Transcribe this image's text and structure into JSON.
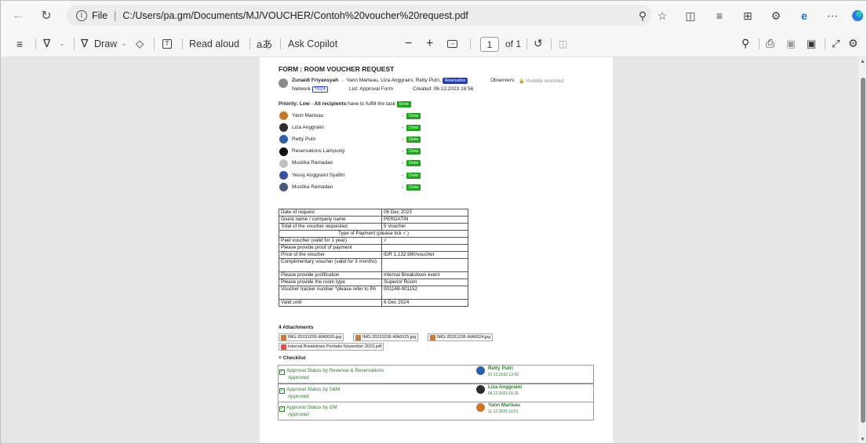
{
  "browser": {
    "file_label": "File",
    "url": "C:/Users/pa.gm/Documents/MJ/VOUCHER/Contoh%20voucher%20request.pdf"
  },
  "pdf_toolbar": {
    "draw_label": "Draw",
    "read_aloud_label": "Read aloud",
    "ask_copilot_label": "Ask Copilot",
    "page_number": "1",
    "page_total": "of 1"
  },
  "form": {
    "title": "FORM : ROOM VOUCHER REQUEST",
    "author": "Zunaidi Friyansyah",
    "arrow": "→",
    "recipients": "Yann Marteau, Liza Anggraini, Retty Putri,",
    "recipients_tag": "Reservation",
    "observers_label": "Observers:",
    "visibility": "Visibility restricted",
    "network_label": "Network",
    "network_tag": "TRIZA",
    "list_label": "List: Approval Form",
    "created": "Created: 06.12.2023 16:56",
    "priority_label": "Priority: Low",
    "priority_sep": " - ",
    "priority_text_bold": "All recipients",
    "priority_text": " have to fulfill the task",
    "done_label": "Done",
    "task_dash": "-",
    "tasks": [
      {
        "name": "Yann Marteau",
        "color": "#c9772f"
      },
      {
        "name": "Liza Anggraini",
        "color": "#2c2c2c"
      },
      {
        "name": "Retty Putri",
        "color": "#2f5fa8"
      },
      {
        "name": "Reservations Lampung",
        "color": "#111111"
      },
      {
        "name": "Mustika Ramadan",
        "color": "#bfbfbf"
      },
      {
        "name": "Yessy Anggraini Syafitri",
        "color": "#3a4fa0"
      },
      {
        "name": "Mustika Ramadan",
        "color": "#4a5a7a"
      }
    ]
  },
  "voucher_table": {
    "rows": [
      {
        "label": "Date of request",
        "value": "06 Dec 2023"
      },
      {
        "label": "Guest name / company name",
        "value": "PERDATIN"
      },
      {
        "label": "Total of the voucher requested",
        "value": "5 Voucher"
      },
      {
        "label": "Type of Payment (please tick √ )",
        "value": "",
        "span": true
      },
      {
        "label": "Paid voucher (valid for 1 year)",
        "value": "√"
      },
      {
        "label": "Please provide proof of payment",
        "value": ""
      },
      {
        "label": "Price of the voucher",
        "value": "IDR 1.132.980/voucher"
      },
      {
        "label": "Complimentary voucher (valid for 3 months)",
        "value": "",
        "tall": true
      },
      {
        "label": "Please provide justification",
        "value": "Internal Breakdown event"
      },
      {
        "label": "Please provide the room type",
        "value": "Superior Room"
      },
      {
        "label": "Voucher tracker number *please refer to PA",
        "value": "001148-001152",
        "tall": true
      },
      {
        "label": "Valid until",
        "value": "6 Dec 2024"
      }
    ]
  },
  "attachments": {
    "title": "4 Attachments",
    "files": [
      {
        "name": "IMG-20231206-WA0026.jpg",
        "type": "img"
      },
      {
        "name": "IMG-20231206-WA0025.jpg",
        "type": "img"
      },
      {
        "name": "IMG-20231206-WA0024.jpg",
        "type": "img"
      },
      {
        "name": "Internal Breakdown Perdatin November 2023.pdf",
        "type": "pdf"
      }
    ]
  },
  "checklist": {
    "title": "Checklist",
    "items": [
      {
        "label": "Approval Status by Revenue & Reservations",
        "status": "Approved",
        "approver": "Retty Putri",
        "date": "07.12.2023 12:43",
        "color": "#2f5fa8"
      },
      {
        "label": "Approval Status by S&M",
        "status": "Approved",
        "approver": "Liza Anggraini",
        "date": "08.12.2023 16:25",
        "color": "#2c2c2c"
      },
      {
        "label": "Approval Status by GM",
        "status": "Approved",
        "approver": "Yann Marteau",
        "date": "11.12.2023 13:51",
        "color": "#c9772f"
      }
    ]
  },
  "colors": {
    "done_badge": "#21a321",
    "approved_text": "#2f7a2f",
    "tag": "#2b3ea8"
  }
}
